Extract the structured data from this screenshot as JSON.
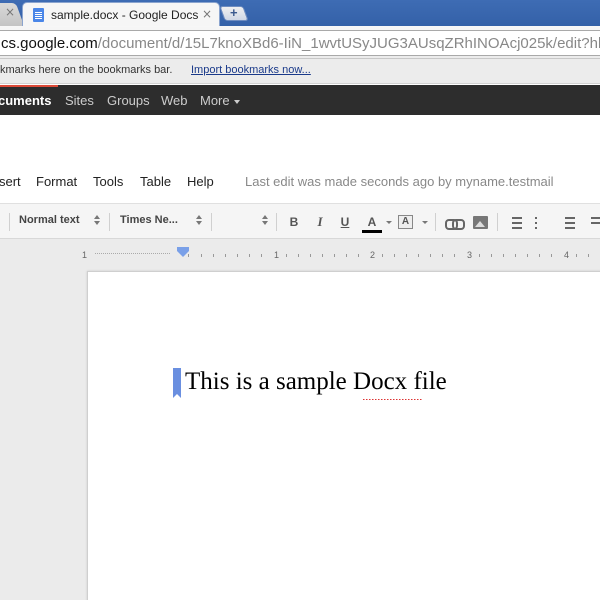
{
  "browser": {
    "tab_title": "sample.docx - Google Docs",
    "tab_close_glyph": "×",
    "prev_tab_close_glyph": "×",
    "new_tab_glyph": "+",
    "url_domain": "cs.google.com",
    "url_path": "/document/d/15L7knoXBd6-IiN_1wvtUSyJUG3AUsqZRhINOAcj025k/edit?hl="
  },
  "bookmarks_bar": {
    "text": "kmarks here on the bookmarks bar.",
    "import_link": "Import bookmarks now..."
  },
  "google_bar": {
    "items": [
      "cuments",
      "Sites",
      "Groups",
      "Web",
      "More"
    ]
  },
  "menu": {
    "items": [
      "sert",
      "Format",
      "Tools",
      "Table",
      "Help"
    ],
    "last_edit": "Last edit was made seconds ago by myname.testmail"
  },
  "toolbar": {
    "style_select": "Normal text",
    "font_select": "Times Ne...",
    "bold_glyph": "B",
    "italic_glyph": "I",
    "underline_glyph": "U",
    "text_color_glyph": "A",
    "highlight_glyph": "A"
  },
  "ruler": {
    "labels": [
      "1",
      "1",
      "2",
      "3",
      "4"
    ]
  },
  "document": {
    "text_before": "This is a sample ",
    "misspelled_word": "Docx",
    "text_after": " file"
  },
  "colors": {
    "chrome_tabstrip": "#3461a8",
    "google_bar": "#2d2d2d",
    "google_bar_accent": "#dd4b39",
    "cursor_marker": "#6a8fe0",
    "spellcheck": "#dd3333"
  },
  "icons": [
    "docs-favicon",
    "close-icon",
    "new-tab-icon",
    "link-icon",
    "image-icon",
    "numbered-list-icon",
    "bulleted-list-icon",
    "outdent-icon",
    "indent-icon",
    "indent-marker-icon"
  ]
}
